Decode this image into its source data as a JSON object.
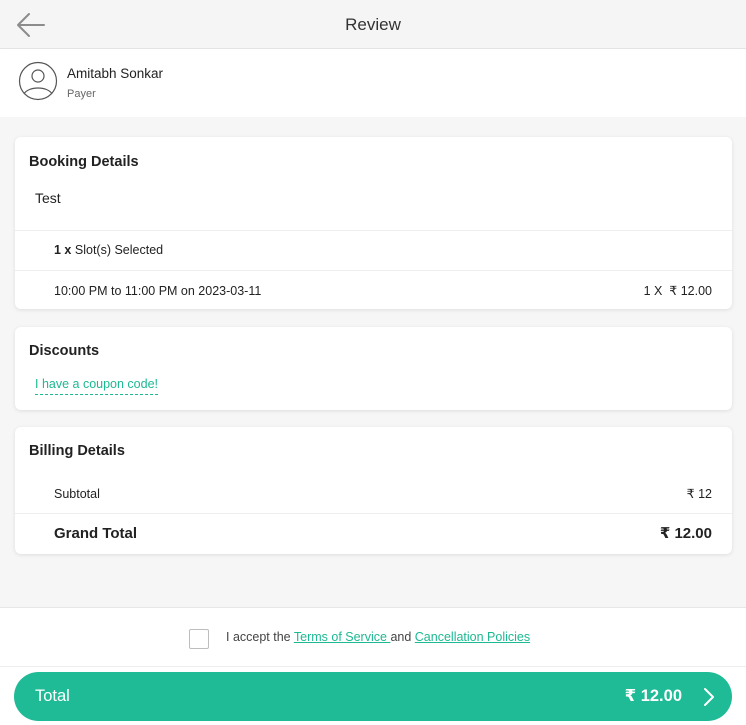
{
  "header": {
    "title": "Review",
    "back_icon": "arrow-left-icon"
  },
  "payer": {
    "avatar_icon": "user-avatar-icon",
    "name": "Amitabh Sonkar",
    "role": "Payer"
  },
  "booking": {
    "title": "Booking Details",
    "item_name": "Test",
    "slot_count": "1 x",
    "slot_label": "Slot(s) Selected",
    "slot_time": "10:00 PM to 11:00 PM on 2023-03-11",
    "slot_price": "1 X  ₹ 12.00"
  },
  "discounts": {
    "title": "Discounts",
    "coupon_link": "I have a coupon code!"
  },
  "billing": {
    "title": "Billing Details",
    "subtotal_label": "Subtotal",
    "subtotal_value": "₹ 12",
    "grand_total_label": "Grand Total",
    "grand_total_value": "₹ 12.00"
  },
  "terms": {
    "prefix": "I accept the ",
    "tos_link": "Terms of Service ",
    "middle": "and ",
    "cancel_link": "Cancellation Policies",
    "checked": false
  },
  "footer": {
    "total_label": "Total",
    "total_value": "₹ 12.00",
    "chevron_icon": "chevron-right-icon"
  },
  "colors": {
    "accent": "#1fbb96",
    "link": "#1db992",
    "header_bg": "#f5f5f5",
    "page_bg": "#f6f6f6"
  }
}
